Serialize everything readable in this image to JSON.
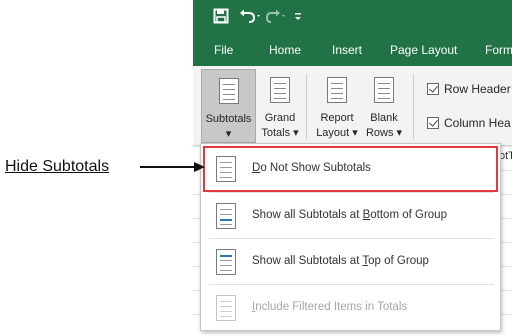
{
  "quick_access": {
    "save_icon": "save-icon",
    "undo_icon": "undo-icon",
    "redo_icon": "redo-icon",
    "customize_icon": "customize-qat-icon"
  },
  "tabs": [
    "File",
    "Home",
    "Insert",
    "Page Layout",
    "Form"
  ],
  "ribbon": {
    "subtotals": {
      "line1": "Subtotals",
      "line2": "▾"
    },
    "grand_totals": {
      "line1": "Grand",
      "line2": "Totals ▾"
    },
    "report_layout": {
      "line1": "Report",
      "line2": "Layout ▾"
    },
    "blank_rows": {
      "line1": "Blank",
      "line2": "Rows ▾"
    },
    "row_headers": "Row Header",
    "column_headers": "Column Hea",
    "pivot_name_fragment": "otT"
  },
  "menu": {
    "items": [
      {
        "pre": "",
        "key": "D",
        "post": "o Not Show Subtotals",
        "enabled": true,
        "highlighted": true
      },
      {
        "pre": "Show all Subtotals at ",
        "key": "B",
        "post": "ottom of Group",
        "enabled": true,
        "highlighted": false
      },
      {
        "pre": "Show all Subtotals at ",
        "key": "T",
        "post": "op of Group",
        "enabled": true,
        "highlighted": false
      },
      {
        "pre": "",
        "key": "I",
        "post": "nclude Filtered Items in Totals",
        "enabled": false,
        "highlighted": false
      }
    ]
  },
  "callout": {
    "text": "Hide Subtotals"
  },
  "colors": {
    "excel_green": "#217346",
    "highlight_red": "#e03a3e"
  }
}
